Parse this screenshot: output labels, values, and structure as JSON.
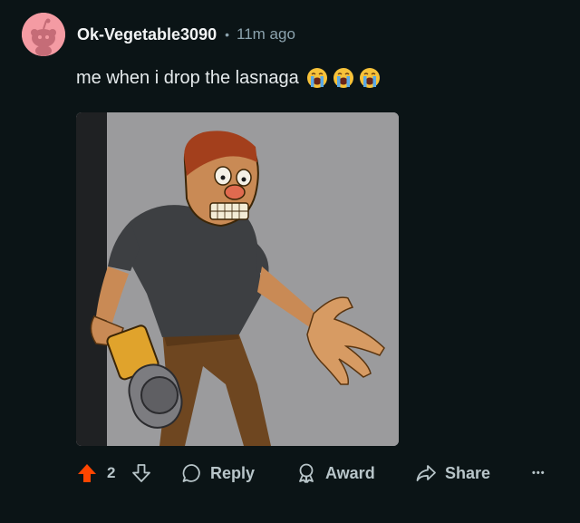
{
  "comment": {
    "username": "Ok-Vegetable3090",
    "separator": "•",
    "timestamp": "11m ago",
    "text": "me when i drop the lasnaga",
    "emojis": [
      "loudly-crying-face",
      "loudly-crying-face",
      "loudly-crying-face"
    ],
    "image_alt": "cartoon man with chainsaw screaming"
  },
  "actions": {
    "score": "2",
    "reply_label": "Reply",
    "award_label": "Award",
    "share_label": "Share",
    "more_label": "•••"
  },
  "colors": {
    "background": "#0b1416",
    "upvote_active": "#ff4500",
    "muted_text": "#8ba2ad",
    "avatar_bg": "#f49ba3"
  }
}
